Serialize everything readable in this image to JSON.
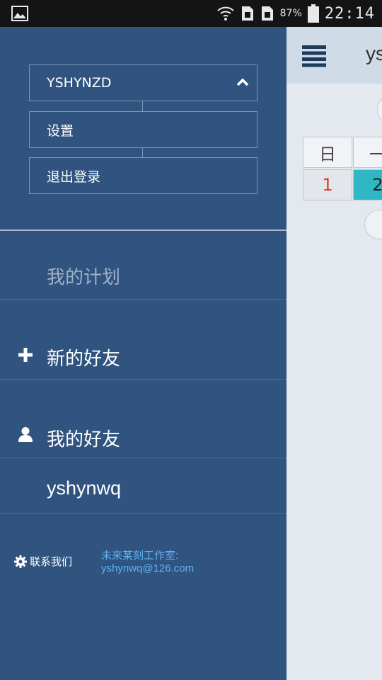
{
  "status_bar": {
    "battery_text": "87%",
    "time": "22:14",
    "icons": [
      "gallery-icon",
      "wifi-icon",
      "sim1-icon",
      "sim2-icon",
      "battery-icon"
    ]
  },
  "drawer": {
    "account": {
      "name": "YSHYNZD",
      "expanded": true
    },
    "account_menu": [
      {
        "label": "设置"
      },
      {
        "label": "退出登录"
      }
    ],
    "menu": {
      "my_plans": "我的计划",
      "new_friends": "新的好友",
      "my_friends": "我的好友",
      "friends": [
        "yshynwq"
      ]
    },
    "footer": {
      "contact_label": "联系我们",
      "studio_line1": "未来某刻工作室:",
      "studio_line2": "yshynwq@126.com"
    }
  },
  "content": {
    "header_title": "ys",
    "calendar": {
      "weekday_headers": [
        "日",
        "一"
      ],
      "days": [
        "1",
        "2"
      ],
      "sunday_color": "#e0411e",
      "selected_color": "#2fb7c6"
    }
  },
  "colors": {
    "drawer_bg": "#30537f",
    "link": "#5fb2f2",
    "muted": "#9fb0c7"
  }
}
